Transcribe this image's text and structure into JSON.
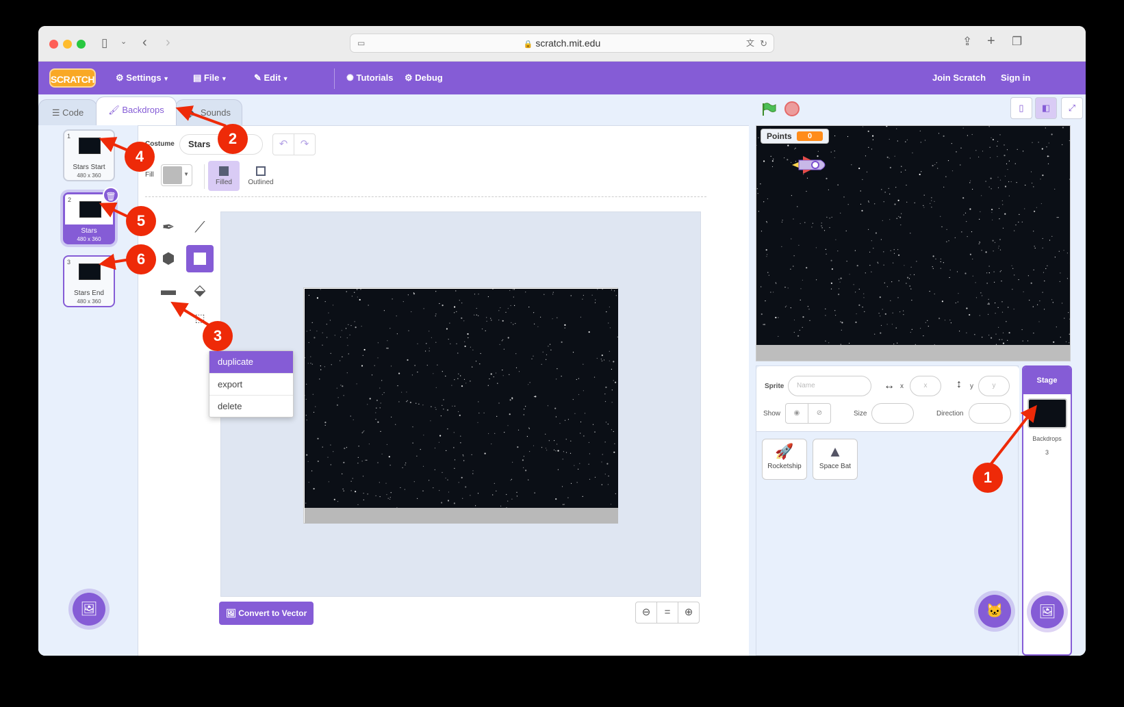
{
  "browser": {
    "url": "scratch.mit.edu"
  },
  "menubar": {
    "logo": "SCRATCH",
    "settings": "Settings",
    "file": "File",
    "edit": "Edit",
    "tutorials": "Tutorials",
    "debug": "Debug",
    "join": "Join Scratch",
    "signin": "Sign in"
  },
  "tabs": {
    "code": "Code",
    "backdrops": "Backdrops",
    "sounds": "Sounds"
  },
  "backdrops": [
    {
      "num": "1",
      "name": "Stars Start",
      "size": "480 x 360"
    },
    {
      "num": "2",
      "name": "Stars",
      "size": "480 x 360"
    },
    {
      "num": "3",
      "name": "Stars End",
      "size": "480 x 360"
    }
  ],
  "context_menu": {
    "duplicate": "duplicate",
    "export": "export",
    "delete": "delete"
  },
  "editor": {
    "costume_label": "Costume",
    "costume_name": "Stars",
    "fill_label": "Fill",
    "filled": "Filled",
    "outlined": "Outlined",
    "convert": "Convert to Vector",
    "zoom_reset": "="
  },
  "stage": {
    "points_label": "Points",
    "points_value": "0"
  },
  "sprite_info": {
    "sprite_label": "Sprite",
    "name_placeholder": "Name",
    "x_label": "x",
    "x_placeholder": "x",
    "y_label": "y",
    "y_placeholder": "y",
    "show_label": "Show",
    "size_label": "Size",
    "direction_label": "Direction"
  },
  "sprites": [
    {
      "name": "Rocketship"
    },
    {
      "name": "Space Bat"
    }
  ],
  "stage_column": {
    "title": "Stage",
    "backdrops_label": "Backdrops",
    "backdrops_count": "3"
  },
  "annotations": [
    "1",
    "2",
    "3",
    "4",
    "5",
    "6"
  ],
  "colors": {
    "accent": "#855cd6",
    "annotation": "#ee2a08",
    "points": "#ff8c1a"
  }
}
